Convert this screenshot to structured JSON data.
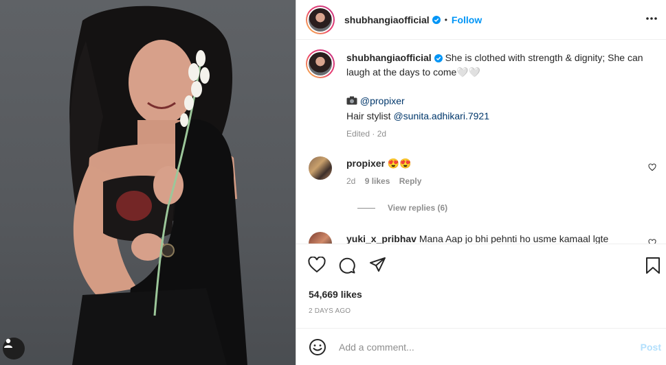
{
  "post": {
    "username": "shubhangiaofficial",
    "follow_label": "Follow",
    "separator": "•",
    "caption": "She is clothed with strength & dignity; She can laugh at the days to come🤍🤍",
    "credit_photo_handle": "@propixer",
    "credit_hair_label": "Hair stylist",
    "credit_hair_handle": "@sunita.adhikari.7921",
    "caption_meta": "Edited · 2d"
  },
  "comments": [
    {
      "username": "propixer",
      "text": "😍😍",
      "age": "2d",
      "likes": "9 likes",
      "reply_label": "Reply",
      "view_replies": "View replies (6)"
    },
    {
      "username": "yuki_x_pribhav",
      "text": "Mana Aap jo bhi pehnti ho usme kamaal lgte"
    }
  ],
  "stats": {
    "likes": "54,669 likes",
    "time": "2 DAYS AGO"
  },
  "composer": {
    "placeholder": "Add a comment...",
    "post_label": "Post"
  },
  "icons": [
    "verified-badge-icon",
    "more-options-icon",
    "heart-icon",
    "comment-icon",
    "share-icon",
    "bookmark-icon",
    "emoji-icon",
    "user-tag-icon"
  ],
  "colors": {
    "link": "#0095f6",
    "mention": "#00376b",
    "post_disabled": "#b2dffc",
    "meta": "#8e8e8e"
  }
}
